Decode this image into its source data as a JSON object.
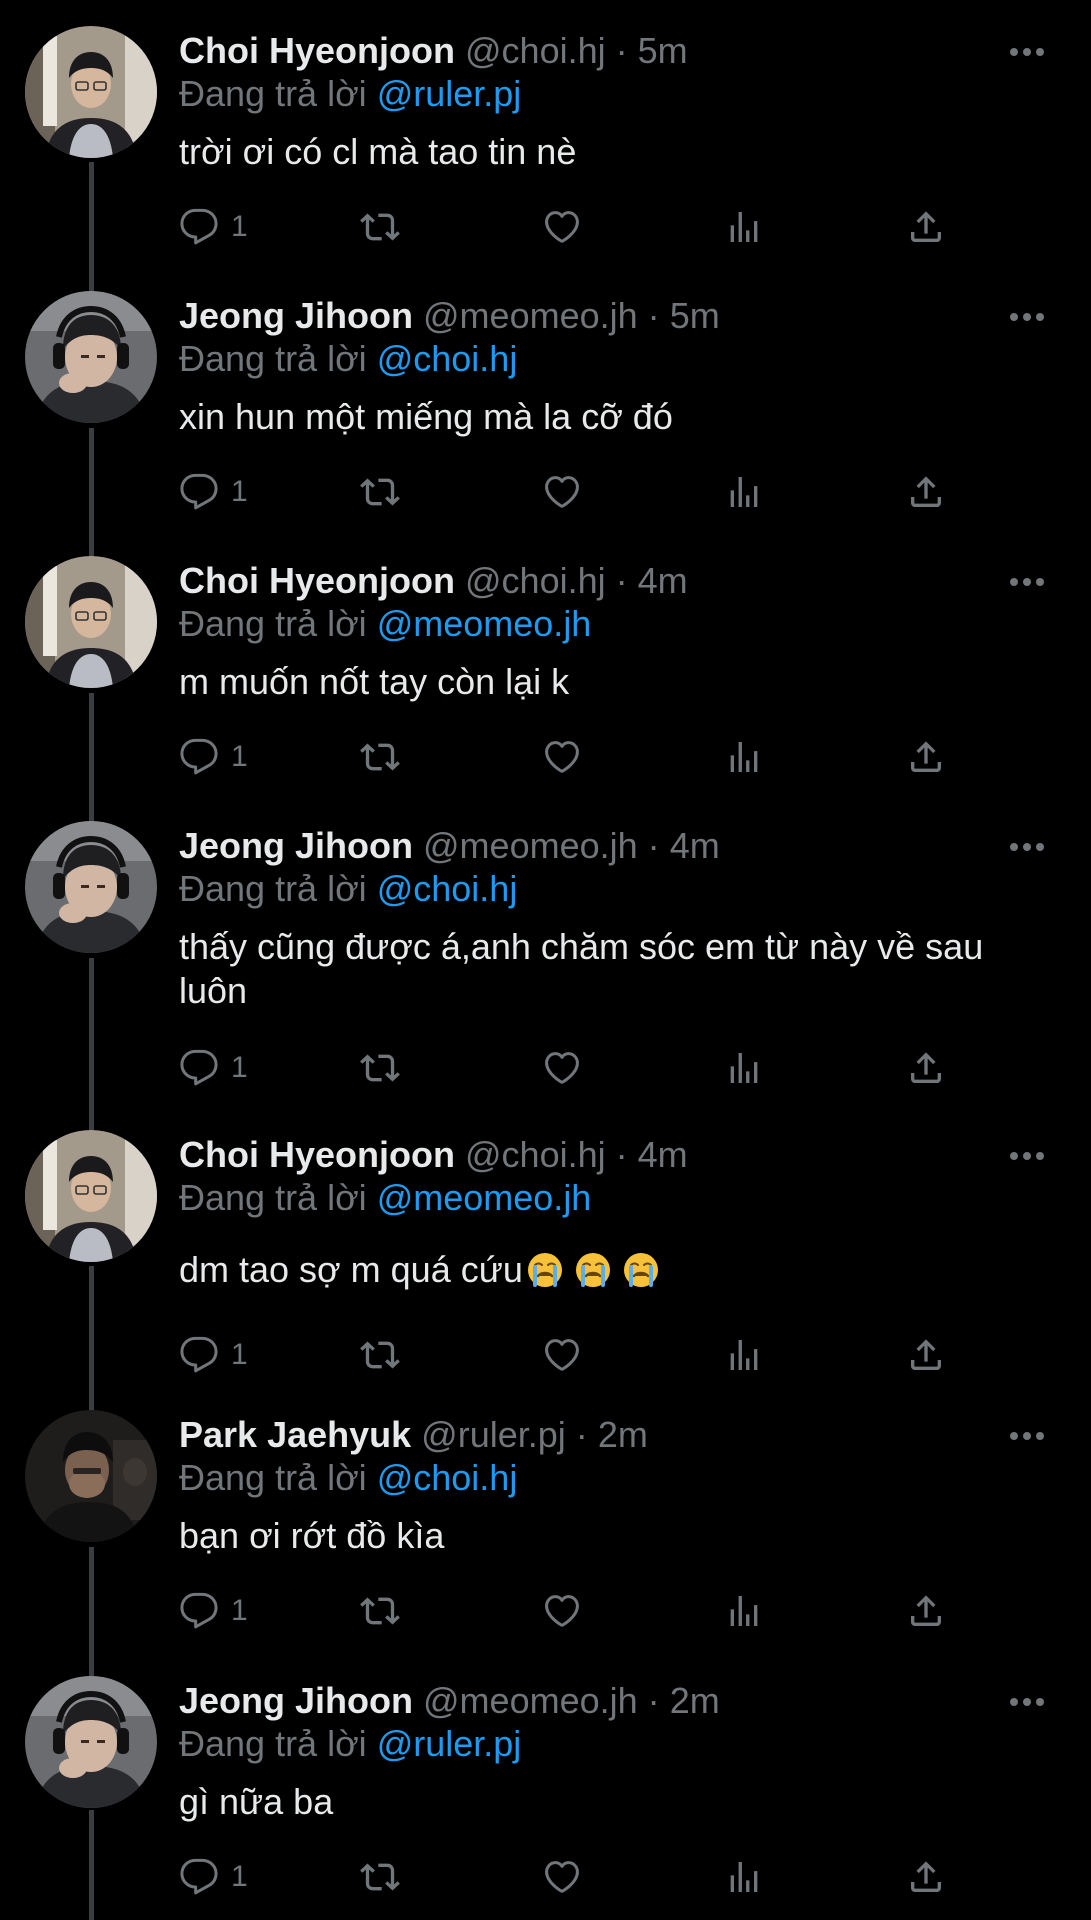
{
  "replying_label": "Đang trả lời",
  "colors": {
    "background": "#000000",
    "name": "#e7e9ea",
    "muted": "#71767b",
    "mention": "#1d9bf0",
    "thread_line": "#3a3d41"
  },
  "icons": {
    "reply": "reply-icon",
    "retweet": "retweet-icon",
    "like": "heart-icon",
    "views": "views-icon",
    "share": "share-icon",
    "more": "more-icon",
    "emoji": "loudly-crying-face-emoji"
  },
  "tweets": [
    {
      "name": "Choi Hyeonjoon",
      "handle": "@choi.hj",
      "dot": "·",
      "time": "5m",
      "replying_to": "@ruler.pj",
      "text": "trời ơi có cl mà tao tin nè",
      "reply_count": "1"
    },
    {
      "name": "Jeong Jihoon",
      "handle": "@meomeo.jh",
      "dot": "·",
      "time": "5m",
      "replying_to": "@choi.hj",
      "text": "xin hun một miếng mà la cỡ đó",
      "reply_count": "1"
    },
    {
      "name": "Choi Hyeonjoon",
      "handle": "@choi.hj",
      "dot": "·",
      "time": "4m",
      "replying_to": "@meomeo.jh",
      "text": "m muốn nốt tay còn lại k",
      "reply_count": "1"
    },
    {
      "name": "Jeong Jihoon",
      "handle": "@meomeo.jh",
      "dot": "·",
      "time": "4m",
      "replying_to": "@choi.hj",
      "text": "thấy cũng được á,anh chăm sóc em từ này về sau luôn",
      "reply_count": "1"
    },
    {
      "name": "Choi Hyeonjoon",
      "handle": "@choi.hj",
      "dot": "·",
      "time": "4m",
      "replying_to": "@meomeo.jh",
      "text": "dm tao sợ m quá cứu",
      "reply_count": "1"
    },
    {
      "name": "Park Jaehyuk",
      "handle": "@ruler.pj",
      "dot": "·",
      "time": "2m",
      "replying_to": "@choi.hj",
      "text": "bạn ơi rớt đồ kìa",
      "reply_count": "1"
    },
    {
      "name": "Jeong Jihoon",
      "handle": "@meomeo.jh",
      "dot": "·",
      "time": "2m",
      "replying_to": "@ruler.pj",
      "text": "gì nữa ba",
      "reply_count": "1"
    }
  ]
}
